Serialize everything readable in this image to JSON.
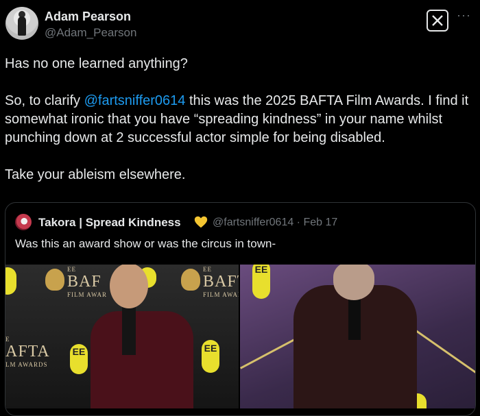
{
  "author": {
    "name": "Adam Pearson",
    "handle": "@Adam_Pearson"
  },
  "header_icons": [
    "x-logo-icon",
    "more-icon"
  ],
  "tweet": {
    "line1": "Has no one learned anything?",
    "para2_before": "So, to clarify ",
    "mention": "@fartsniffer0614",
    "para2_after": " this was the 2025 BAFTA Film Awards. I find it somewhat ironic that you have “spreading kindness” in your name whilst punching down at 2 successful actor simple for being disabled.",
    "line3": "Take your ableism elsewhere."
  },
  "quote": {
    "name": "Takora | Spread Kindness",
    "badge_icon": "yellow-heart-icon",
    "meta": "@fartsniffer0614 · Feb 17",
    "text": "Was this an award show or was the circus in town-"
  },
  "photo_labels": {
    "ee": "EE",
    "baf": "BAF",
    "film_awar": "FILM AWAR",
    "baft": "BAFT",
    "film_awari": "FILM AWARI",
    "e_small": "E",
    "afta": "AFTA",
    "lm_awards": "LM AWARDS",
    "ee_column": "EE"
  },
  "colors": {
    "background": "#000000",
    "text": "#e7e9ea",
    "muted": "#71767b",
    "link": "#1d9bf0",
    "border": "#2f3336"
  }
}
